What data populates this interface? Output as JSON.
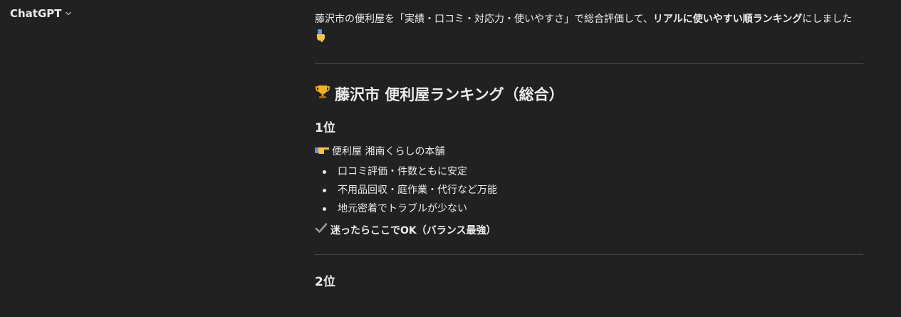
{
  "header": {
    "model_name": "ChatGPT",
    "chevron_icon": "chevron-down-icon"
  },
  "message": {
    "intro_plain": "藤沢市の便利屋を「実績・口コミ・対応力・使いやすさ」で総合評価して、",
    "intro_bold": "リアルに使いやすい順ランキング",
    "intro_tail": "にしました",
    "intro_emoji": "pointing-down-hand-icon",
    "heading": "藤沢市 便利屋ランキング（総合）",
    "heading_emoji": "trophy-icon",
    "rank1": {
      "title": "1位",
      "shop_icon": "pointing-right-hand-icon",
      "shop_name": "便利屋 湘南くらしの本舗",
      "points": [
        "口コミ評価・件数ともに安定",
        "不用品回収・庭作業・代行など万能",
        "地元密着でトラブルが少ない"
      ],
      "verdict_icon": "check-mark-icon",
      "verdict": "迷ったらここでOK（バランス最強）"
    },
    "rank2": {
      "title": "2位"
    }
  },
  "colors": {
    "background": "#212121",
    "text": "#ececec",
    "divider": "#4a4a4a"
  }
}
